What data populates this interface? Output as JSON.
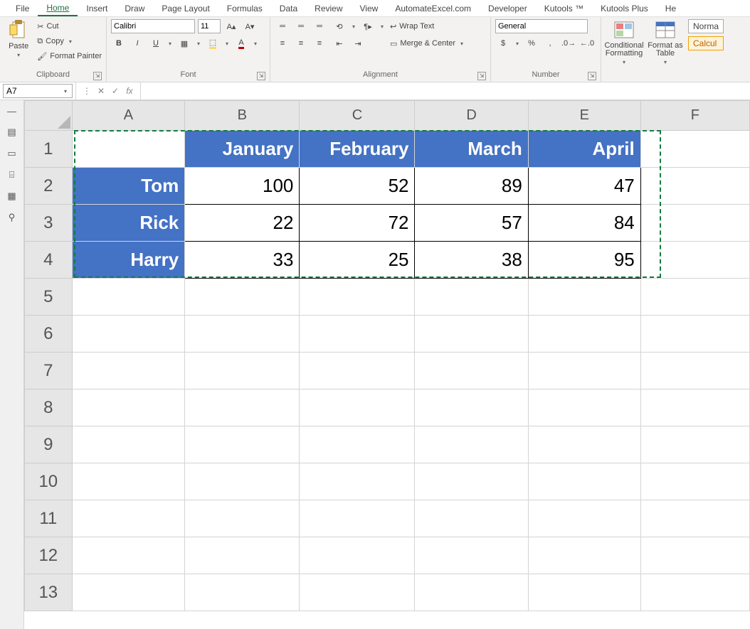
{
  "menu": {
    "tabs": [
      "File",
      "Home",
      "Insert",
      "Draw",
      "Page Layout",
      "Formulas",
      "Data",
      "Review",
      "View",
      "AutomateExcel.com",
      "Developer",
      "Kutools ™",
      "Kutools Plus",
      "He"
    ],
    "active": "Home"
  },
  "ribbon": {
    "clipboard": {
      "label": "Clipboard",
      "paste": "Paste",
      "cut": "Cut",
      "copy": "Copy",
      "format_painter": "Format Painter"
    },
    "font": {
      "label": "Font",
      "name": "Calibri",
      "size": "11"
    },
    "alignment": {
      "label": "Alignment",
      "wrap": "Wrap Text",
      "merge": "Merge & Center"
    },
    "number": {
      "label": "Number",
      "format": "General"
    },
    "styles": {
      "conditional": "Conditional Formatting",
      "formatas": "Format as Table",
      "normal": "Norma",
      "calc": "Calcul"
    }
  },
  "namebox": "A7",
  "formula": "",
  "columns": [
    "A",
    "B",
    "C",
    "D",
    "E",
    "F"
  ],
  "row_numbers": [
    "1",
    "2",
    "3",
    "4",
    "5",
    "6",
    "7",
    "8",
    "9",
    "10",
    "11",
    "12",
    "13"
  ],
  "sheet": {
    "headers": [
      "January",
      "February",
      "March",
      "April"
    ],
    "rows": [
      {
        "name": "Tom",
        "vals": [
          "100",
          "52",
          "89",
          "47"
        ]
      },
      {
        "name": "Rick",
        "vals": [
          "22",
          "72",
          "57",
          "84"
        ]
      },
      {
        "name": "Harry",
        "vals": [
          "33",
          "25",
          "38",
          "95"
        ]
      }
    ]
  }
}
